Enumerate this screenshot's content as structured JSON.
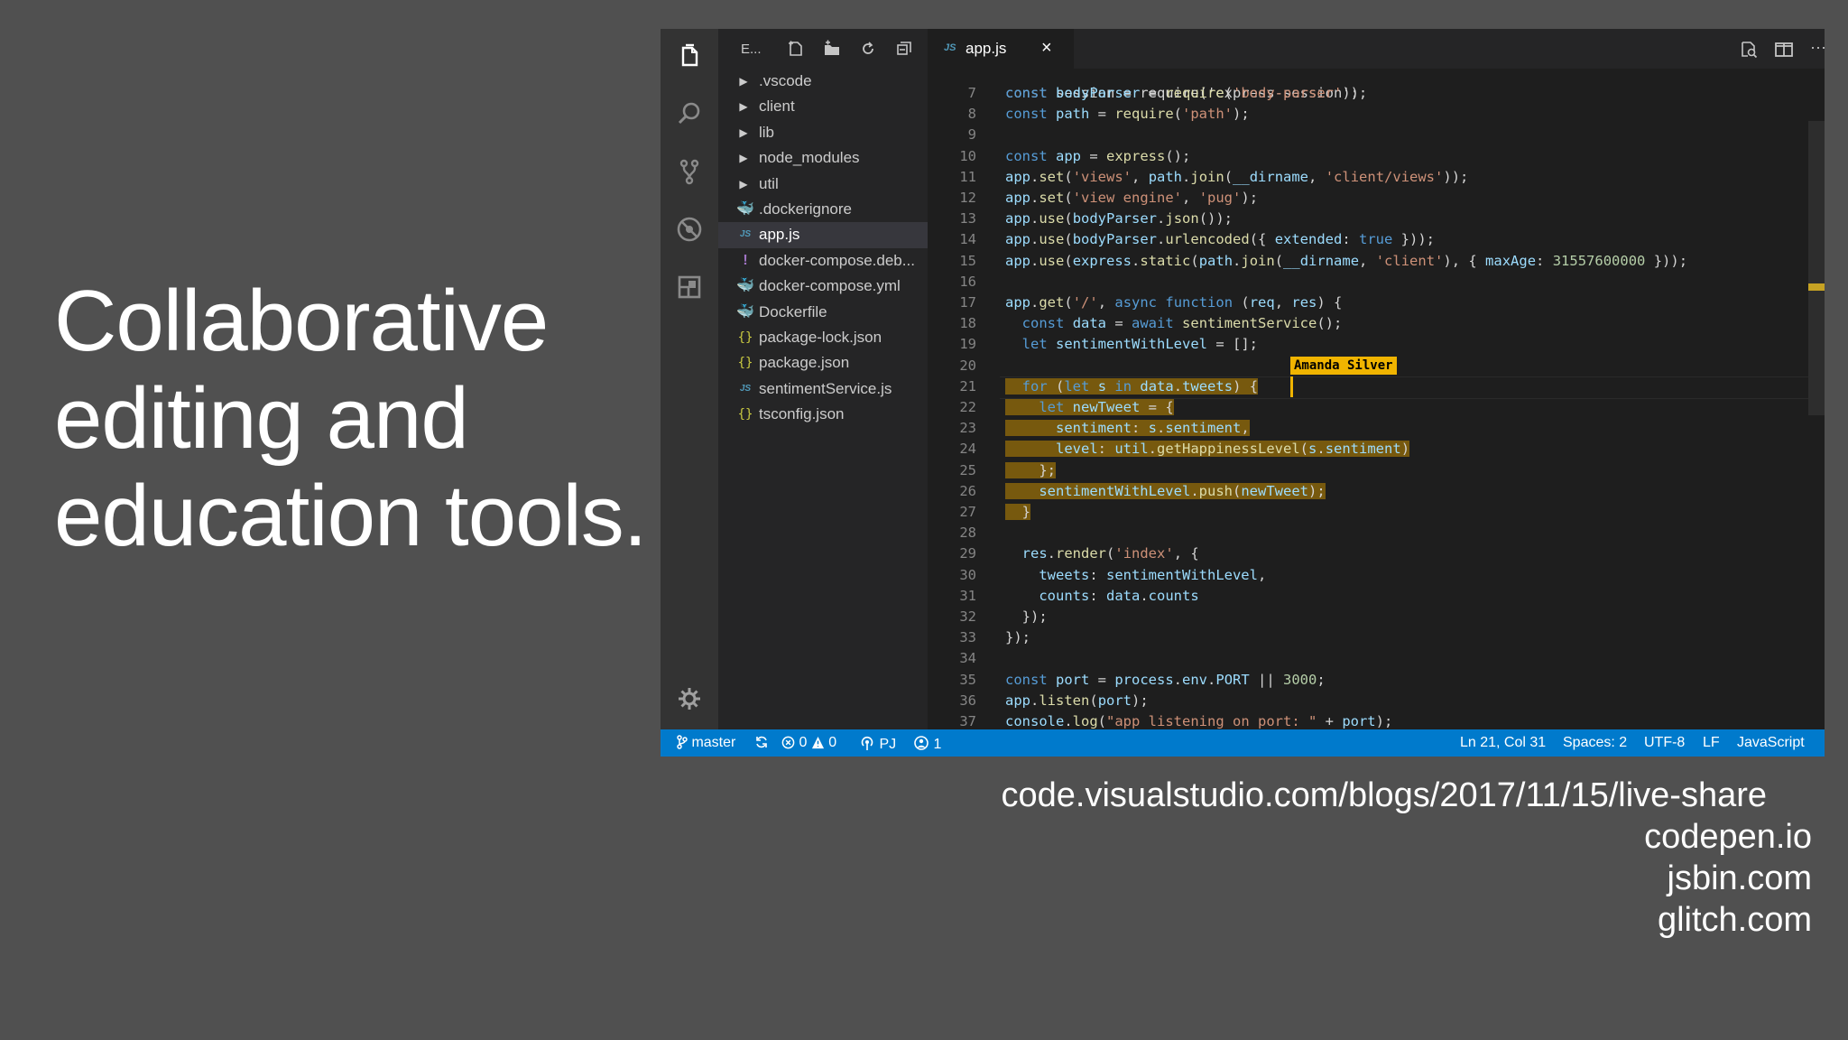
{
  "slide": {
    "title_lines": [
      "Collaborative",
      "editing and",
      "education tools."
    ],
    "links": [
      "code.visualstudio.com/blogs/2017/11/15/live-share",
      "codepen.io",
      "jsbin.com",
      "glitch.com"
    ]
  },
  "activity_bar": {
    "icons": [
      "files-icon",
      "search-icon",
      "source-control-icon",
      "debug-icon",
      "extensions-icon",
      "settings-gear-icon"
    ]
  },
  "explorer": {
    "title": "E...",
    "items": [
      {
        "label": ".vscode",
        "icon": "chevron-right-icon",
        "selected": false
      },
      {
        "label": "client",
        "icon": "chevron-right-icon",
        "selected": false
      },
      {
        "label": "lib",
        "icon": "chevron-right-icon",
        "selected": false
      },
      {
        "label": "node_modules",
        "icon": "chevron-right-icon",
        "selected": false
      },
      {
        "label": "util",
        "icon": "chevron-right-icon",
        "selected": false
      },
      {
        "label": ".dockerignore",
        "icon": "docker-icon",
        "selected": false
      },
      {
        "label": "app.js",
        "icon": "js-file-icon",
        "selected": true
      },
      {
        "label": "docker-compose.deb...",
        "icon": "yaml-file-icon",
        "selected": false
      },
      {
        "label": "docker-compose.yml",
        "icon": "docker-icon",
        "selected": false
      },
      {
        "label": "Dockerfile",
        "icon": "docker-icon",
        "selected": false
      },
      {
        "label": "package-lock.json",
        "icon": "json-file-icon",
        "selected": false
      },
      {
        "label": "package.json",
        "icon": "json-file-icon",
        "selected": false
      },
      {
        "label": "sentimentService.js",
        "icon": "js-file-icon",
        "selected": false
      },
      {
        "label": "tsconfig.json",
        "icon": "json-file-icon",
        "selected": false
      }
    ]
  },
  "tab": {
    "icon_label": "JS",
    "label": "app.js",
    "close": "×"
  },
  "editor": {
    "partial_line": "const session = require('express-session');",
    "lines": [
      {
        "n": "7",
        "code": "const bodyParser = require('body-parser');"
      },
      {
        "n": "8",
        "code": "const path = require('path');"
      },
      {
        "n": "9",
        "code": ""
      },
      {
        "n": "10",
        "code": "const app = express();"
      },
      {
        "n": "11",
        "code": "app.set('views', path.join(__dirname, 'client/views'));"
      },
      {
        "n": "12",
        "code": "app.set('view engine', 'pug');"
      },
      {
        "n": "13",
        "code": "app.use(bodyParser.json());"
      },
      {
        "n": "14",
        "code": "app.use(bodyParser.urlencoded({ extended: true }));"
      },
      {
        "n": "15",
        "code": "app.use(express.static(path.join(__dirname, 'client'), { maxAge: 31557600000 }));"
      },
      {
        "n": "16",
        "code": ""
      },
      {
        "n": "17",
        "code": "app.get('/', async function (req, res) {"
      },
      {
        "n": "18",
        "code": "  const data = await sentimentService();"
      },
      {
        "n": "19",
        "code": "  let sentimentWithLevel = [];"
      },
      {
        "n": "20",
        "code": ""
      },
      {
        "n": "21",
        "code": "  for (let s in data.tweets) {"
      },
      {
        "n": "22",
        "code": "    let newTweet = {"
      },
      {
        "n": "23",
        "code": "      sentiment: s.sentiment,"
      },
      {
        "n": "24",
        "code": "      level: util.getHappinessLevel(s.sentiment)"
      },
      {
        "n": "25",
        "code": "    };"
      },
      {
        "n": "26",
        "code": "    sentimentWithLevel.push(newTweet);"
      },
      {
        "n": "27",
        "code": "  }"
      },
      {
        "n": "28",
        "code": ""
      },
      {
        "n": "29",
        "code": "  res.render('index', {"
      },
      {
        "n": "30",
        "code": "    tweets: sentimentWithLevel,"
      },
      {
        "n": "31",
        "code": "    counts: data.counts"
      },
      {
        "n": "32",
        "code": "  });"
      },
      {
        "n": "33",
        "code": "});"
      },
      {
        "n": "34",
        "code": ""
      },
      {
        "n": "35",
        "code": "const port = process.env.PORT || 3000;"
      },
      {
        "n": "36",
        "code": "app.listen(port);"
      },
      {
        "n": "37",
        "code": "console.log(\"app listening on port: \" + port);"
      }
    ],
    "collaborator": "Amanda Silver",
    "highlight_color": "#f0b400"
  },
  "status_bar": {
    "branch": "master",
    "errors": "0",
    "warnings": "0",
    "live_share": "PJ",
    "participants": "1",
    "position": "Ln 21, Col 31",
    "spaces": "Spaces: 2",
    "encoding": "UTF-8",
    "eol": "LF",
    "language": "JavaScript",
    "color": "#007acc"
  }
}
